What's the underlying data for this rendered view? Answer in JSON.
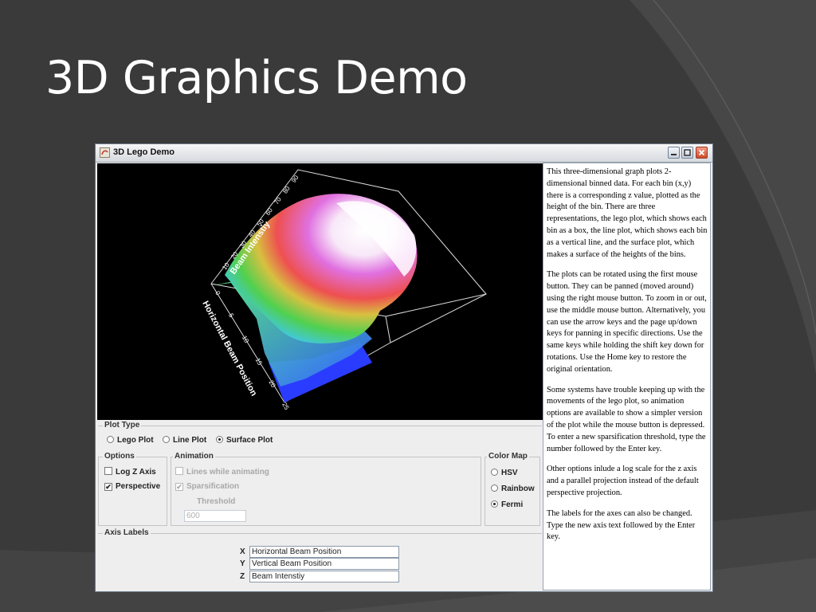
{
  "slide": {
    "title": "3D Graphics Demo"
  },
  "window": {
    "title": "3D Lego Demo"
  },
  "plot": {
    "axis_y_label": "Beam Intenstiy",
    "axis_x_label": "Horizontal Beam Position",
    "y_ticks": [
      "10",
      "20",
      "30",
      "40",
      "50",
      "60",
      "70",
      "80",
      "90"
    ],
    "x_ticks": [
      "0",
      "5",
      "10",
      "15",
      "20",
      "25"
    ]
  },
  "plot_type": {
    "label": "Plot Type",
    "options": [
      "Lego Plot",
      "Line Plot",
      "Surface Plot"
    ],
    "selected": "Surface Plot"
  },
  "options": {
    "label": "Options",
    "log_z": {
      "label": "Log Z Axis",
      "checked": false
    },
    "perspective": {
      "label": "Perspective",
      "checked": true
    }
  },
  "animation": {
    "label": "Animation",
    "lines_while_animating": {
      "label": "Lines while animating",
      "checked": false
    },
    "sparsification": {
      "label": "Sparsification",
      "checked": true
    },
    "threshold_label": "Threshold",
    "threshold_value": "600"
  },
  "color_map": {
    "label": "Color Map",
    "options": [
      "HSV",
      "Rainbow",
      "Fermi"
    ],
    "selected": "Fermi"
  },
  "axis_labels": {
    "label": "Axis Labels",
    "x_letter": "X",
    "x_value": "Horizontal Beam Position",
    "y_letter": "Y",
    "y_value": "Vertical Beam Position",
    "z_letter": "Z",
    "z_value": "Beam Intenstiy"
  },
  "info": {
    "paragraphs": [
      "This three-dimensional graph plots 2-dimensional binned data. For each bin (x,y) there is a corresponding z value, plotted as the height of the bin. There are three representations, the lego plot, which shows each bin as a box, the line plot, which shows each bin as a vertical line, and the surface plot, which makes a surface of the heights of the bins.",
      "The plots can be rotated using the first mouse button. They can be panned (moved around) using the right mouse button. To zoom in or out, use the middle mouse button. Alternatively, you can use the arrow keys and the page up/down keys for panning in specific directions. Use the same keys while holding the shift key down for rotations. Use the Home key to restore the original orientation.",
      "Some systems have trouble keeping up with the movements of the lego plot, so animation options are available to show a simpler version of the plot while the mouse button is depressed. To enter a new sparsification threshold, type the number followed by the Enter key.",
      "Other options inlude a log scale for the z axis and a parallel projection instead of the default perspective projection.",
      "The labels for the axes can also be changed. Type the new axis text followed by the Enter key."
    ]
  }
}
